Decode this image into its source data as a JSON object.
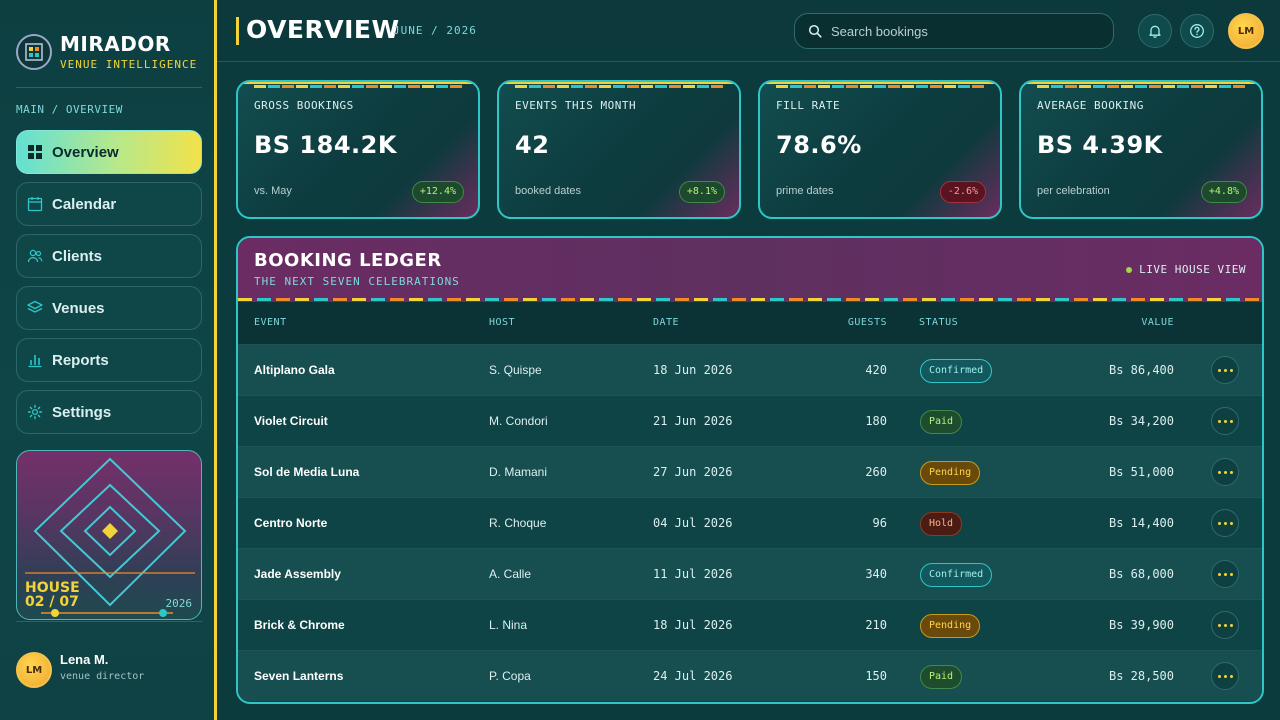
{
  "brand": {
    "name": "MIRADOR",
    "tagline": "VENUE INTELLIGENCE"
  },
  "sidebar": {
    "breadcrumb": "MAIN / OVERVIEW",
    "items": [
      {
        "label": "Overview",
        "icon": "grid-icon",
        "active": true
      },
      {
        "label": "Calendar",
        "icon": "calendar-icon",
        "active": false
      },
      {
        "label": "Clients",
        "icon": "users-icon",
        "active": false
      },
      {
        "label": "Venues",
        "icon": "layers-icon",
        "active": false
      },
      {
        "label": "Reports",
        "icon": "bar-chart-icon",
        "active": false
      },
      {
        "label": "Settings",
        "icon": "gear-icon",
        "active": false
      }
    ],
    "house_card": {
      "title_line1": "HOUSE",
      "title_line2": "02 / 07",
      "year": "2026"
    },
    "user": {
      "initials": "LM",
      "name": "Lena M.",
      "role": "venue director"
    }
  },
  "header": {
    "title": "OVERVIEW",
    "date": "JUNE / 2026",
    "search_placeholder": "Search bookings",
    "avatar_initials": "LM"
  },
  "kpis": [
    {
      "label": "GROSS BOOKINGS",
      "value": "BS 184.2K",
      "sub": "vs. May",
      "delta": "+12.4%",
      "trend": "up"
    },
    {
      "label": "EVENTS THIS MONTH",
      "value": "42",
      "sub": "booked dates",
      "delta": "+8.1%",
      "trend": "up"
    },
    {
      "label": "FILL RATE",
      "value": "78.6%",
      "sub": "prime dates",
      "delta": "-2.6%",
      "trend": "down"
    },
    {
      "label": "AVERAGE BOOKING",
      "value": "BS 4.39K",
      "sub": "per celebration",
      "delta": "+4.8%",
      "trend": "up"
    }
  ],
  "ledger": {
    "title": "BOOKING LEDGER",
    "subtitle": "THE NEXT SEVEN CELEBRATIONS",
    "live_label": "LIVE HOUSE VIEW",
    "columns": {
      "event": "EVENT",
      "host": "HOST",
      "date": "DATE",
      "guests": "GUESTS",
      "status": "STATUS",
      "value": "VALUE"
    },
    "rows": [
      {
        "event": "Altiplano Gala",
        "host": "S. Quispe",
        "date": "18 Jun 2026",
        "guests": "420",
        "status": "Confirmed",
        "value": "Bs 86,400"
      },
      {
        "event": "Violet Circuit",
        "host": "M. Condori",
        "date": "21 Jun 2026",
        "guests": "180",
        "status": "Paid",
        "value": "Bs 34,200"
      },
      {
        "event": "Sol de Media Luna",
        "host": "D. Mamani",
        "date": "27 Jun 2026",
        "guests": "260",
        "status": "Pending",
        "value": "Bs 51,000"
      },
      {
        "event": "Centro Norte",
        "host": "R. Choque",
        "date": "04 Jul 2026",
        "guests": "96",
        "status": "Hold",
        "value": "Bs 14,400"
      },
      {
        "event": "Jade Assembly",
        "host": "A. Calle",
        "date": "11 Jul 2026",
        "guests": "340",
        "status": "Confirmed",
        "value": "Bs 68,000"
      },
      {
        "event": "Brick & Chrome",
        "host": "L. Nina",
        "date": "18 Jul 2026",
        "guests": "210",
        "status": "Pending",
        "value": "Bs 39,900"
      },
      {
        "event": "Seven Lanterns",
        "host": "P. Copa",
        "date": "24 Jul 2026",
        "guests": "150",
        "status": "Paid",
        "value": "Bs 28,500"
      }
    ]
  },
  "colors": {
    "accent_yellow": "#f2d43a",
    "accent_teal": "#2ec6c6",
    "accent_orange": "#f08a24",
    "magenta": "#6a2c63"
  }
}
